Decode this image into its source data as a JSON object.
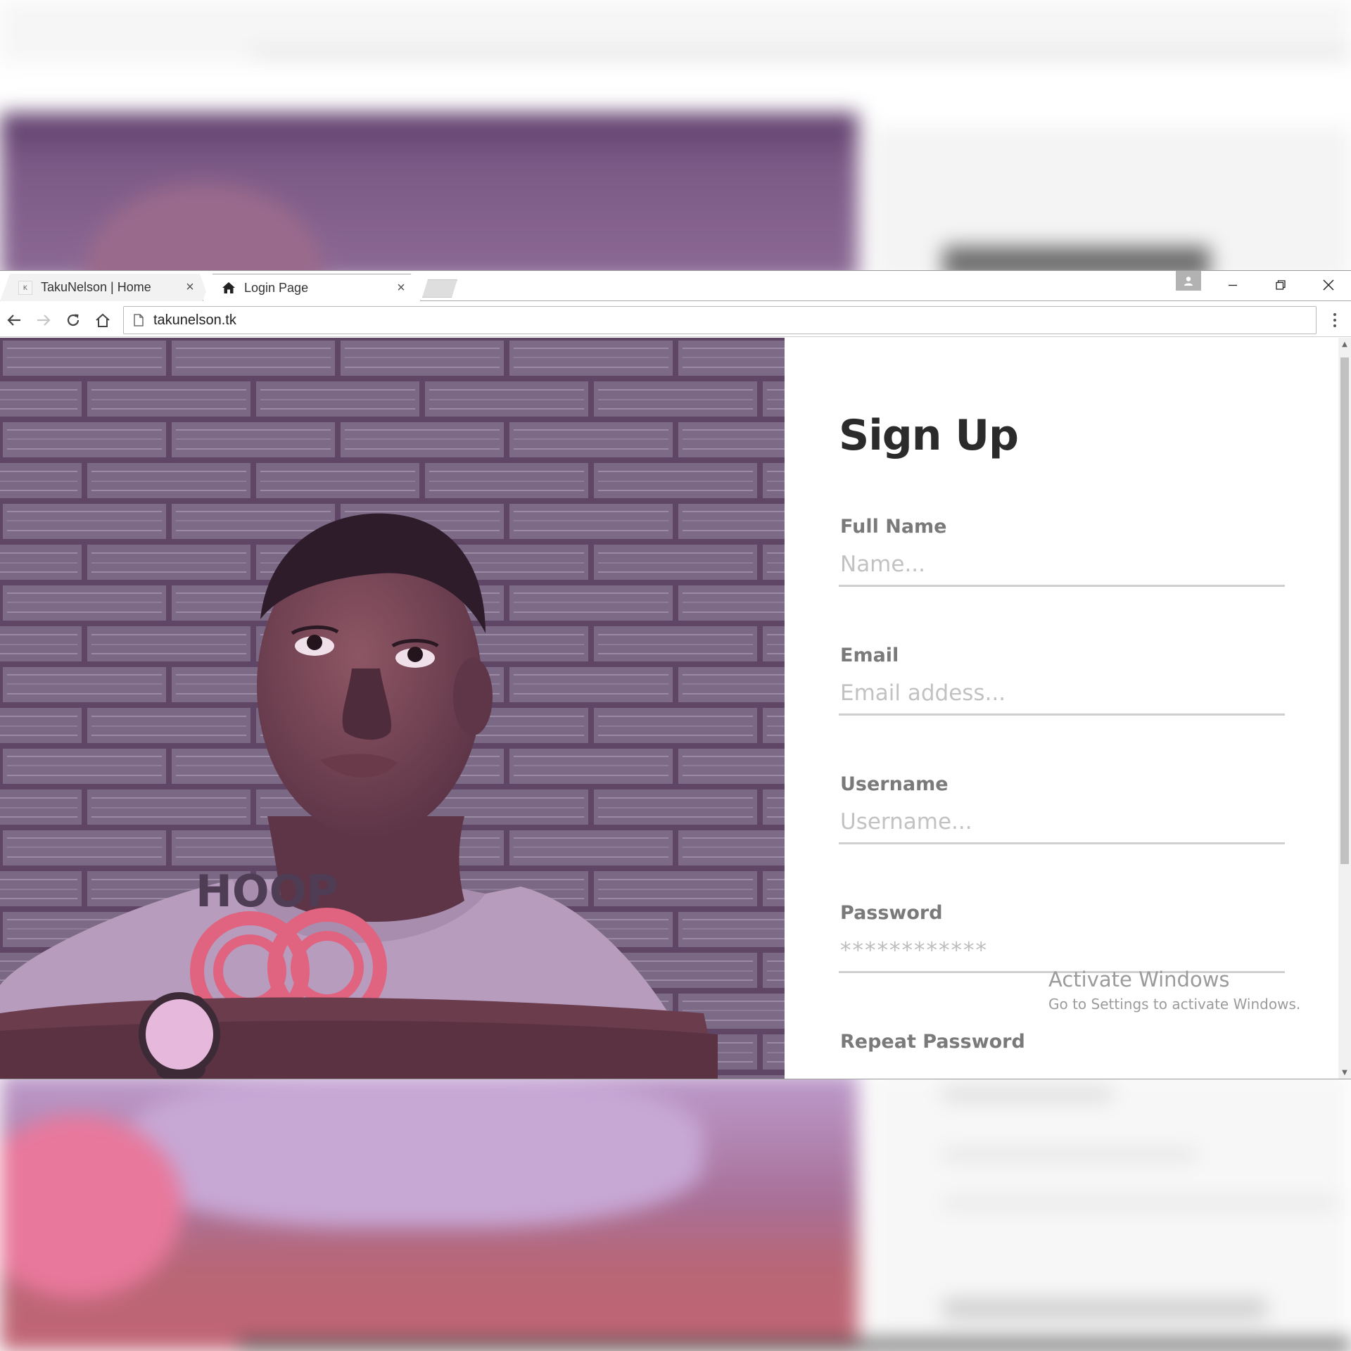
{
  "browser": {
    "tabs": [
      {
        "title": "TakuNelson | Home",
        "favicon": "k-logo-icon",
        "active": false
      },
      {
        "title": "Login Page",
        "favicon": "home-icon",
        "active": true
      }
    ],
    "url": "takunelson.tk",
    "tab_close_glyph": "×"
  },
  "signup": {
    "title": "Sign Up",
    "fields": [
      {
        "label": "Full Name",
        "placeholder": "Name..."
      },
      {
        "label": "Email",
        "placeholder": "Email addess..."
      },
      {
        "label": "Username",
        "placeholder": "Username..."
      },
      {
        "label": "Password",
        "placeholder": "************"
      },
      {
        "label": "Repeat Password",
        "placeholder": ""
      }
    ]
  },
  "photo": {
    "shirt_text": "HOOP"
  },
  "watermark": {
    "title": "Activate Windows",
    "subtitle": "Go to Settings to activate Windows."
  },
  "colors": {
    "photo_tint": "#5e4766",
    "title": "#2b2b2b",
    "label": "#7a7a7a",
    "placeholder": "#c2c2c2"
  }
}
